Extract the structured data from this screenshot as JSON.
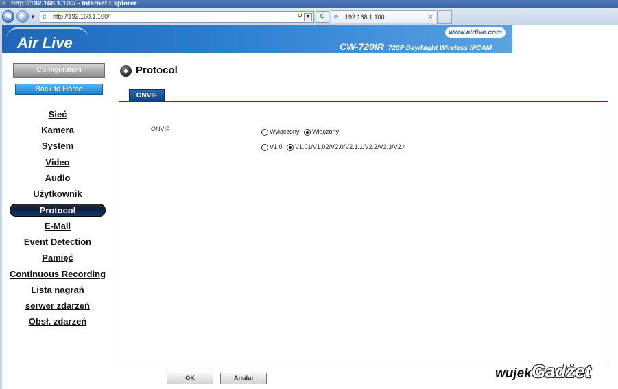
{
  "window": {
    "title": "http://192.168.1.100/ - Internet Explorer",
    "address": "http://192.168.1.100/",
    "tab_title": "192.168.1.100"
  },
  "banner": {
    "logo": "Air Live",
    "website": "www.airlive.com",
    "model": "CW-720IR",
    "model_desc": "720P Day/Night Wireless IPCAM"
  },
  "sidebar": {
    "configuration": "Configuration",
    "back_home": "Back to Home",
    "items": [
      {
        "label": "Sieć"
      },
      {
        "label": "Kamera"
      },
      {
        "label": "System"
      },
      {
        "label": "Video"
      },
      {
        "label": "Audio"
      },
      {
        "label": "Użytkownik"
      },
      {
        "label": "Protocol",
        "active": true
      },
      {
        "label": "E-Mail"
      },
      {
        "label": "Event Detection"
      },
      {
        "label": "Pamięć"
      },
      {
        "label": "Continuous Recording"
      },
      {
        "label": "Lista nagrań"
      },
      {
        "label": "serwer zdarzeń"
      },
      {
        "label": "Obsł. zdarzeń"
      }
    ]
  },
  "main": {
    "title": "Protocol",
    "tab": "ONVIF",
    "onvif": {
      "label": "ONVIF",
      "state_options": [
        "Wyłączony",
        "Włączony"
      ],
      "state_selected": "Włączony",
      "version_options": [
        "V1.0",
        "V1.01/V1.02/V2.0/V2.1.1/V2.2/V2.3/V2.4"
      ],
      "version_selected": "V1.01/V1.02/V2.0/V2.1.1/V2.2/V2.3/V2.4"
    },
    "ok_label": "OK",
    "cancel_label": "Anuluj"
  },
  "watermark": {
    "part1": "wujek",
    "part2": "Gadżet"
  },
  "colors": {
    "accent": "#1f66b8",
    "active_menu": "#0b1f3f",
    "tab": "#0e3f7e"
  }
}
